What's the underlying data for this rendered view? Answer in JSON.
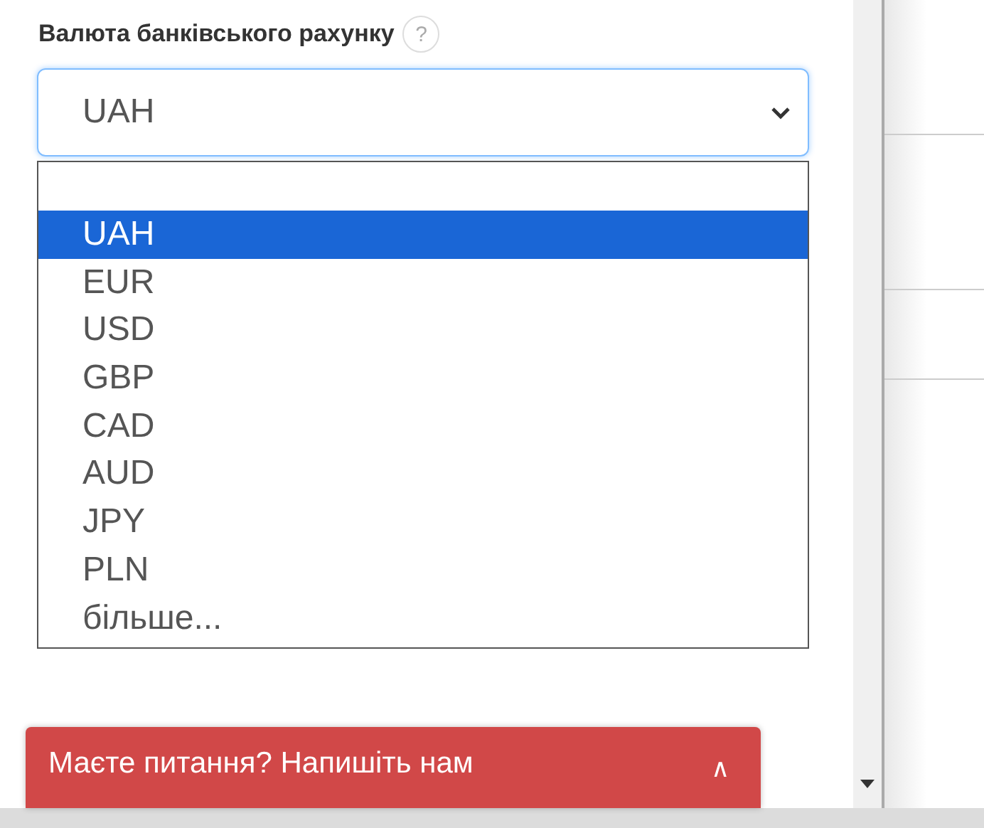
{
  "field": {
    "label": "Валюта банківського рахунку",
    "help": "?",
    "value": "UAH"
  },
  "dropdown": {
    "options": [
      {
        "label": "UAH",
        "selected": true
      },
      {
        "label": "EUR",
        "selected": false
      },
      {
        "label": "USD",
        "selected": false
      },
      {
        "label": "GBP",
        "selected": false
      },
      {
        "label": "CAD",
        "selected": false
      },
      {
        "label": "AUD",
        "selected": false
      },
      {
        "label": "JPY",
        "selected": false
      },
      {
        "label": "PLN",
        "selected": false
      },
      {
        "label": "більше...",
        "selected": false
      }
    ]
  },
  "chat": {
    "label": "Маєте питання? Напишіть нам",
    "toggle": "∧"
  }
}
